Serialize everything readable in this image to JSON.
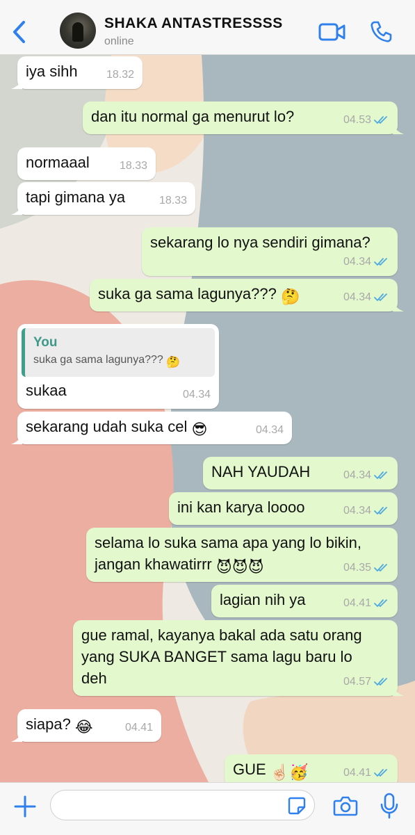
{
  "header": {
    "back_icon": "chevron-left-icon",
    "contact_name": "SHAKA ANTASTRESSSS",
    "status": "online",
    "video_icon": "video-camera-icon",
    "call_icon": "phone-icon",
    "accent": "#2f80ed"
  },
  "messages": [
    {
      "dir": "in",
      "text": "iya sihh",
      "time": "18.32"
    },
    {
      "dir": "out",
      "text": "dan itu normal ga menurut lo?",
      "time": "04.53",
      "read": true
    },
    {
      "dir": "in",
      "text": "normaaal",
      "time": "18.33"
    },
    {
      "dir": "in",
      "text": "tapi gimana ya",
      "time": "18.33"
    },
    {
      "dir": "out",
      "text": "sekarang lo nya sendiri gimana?",
      "time": "04.34",
      "read": true
    },
    {
      "dir": "out",
      "text": "suka ga sama lagunya???",
      "emoji": "🤔",
      "time": "04.34",
      "read": true
    },
    {
      "dir": "in",
      "quote_author": "You",
      "quote_text": "suka ga sama lagunya???",
      "quote_emoji": "🤔",
      "text": "sukaa",
      "time": "04.34"
    },
    {
      "dir": "in",
      "text": "sekarang udah suka cel",
      "emoji": "😎",
      "time": "04.34"
    },
    {
      "dir": "out",
      "text": "NAH YAUDAH",
      "time": "04.34",
      "read": true
    },
    {
      "dir": "out",
      "text": "ini kan karya loooo",
      "time": "04.34",
      "read": true
    },
    {
      "dir": "out",
      "text": "selama lo suka sama apa yang lo bikin,\njangan khawatirrr",
      "emoji": "😈😈😈",
      "time": "04.35",
      "read": true
    },
    {
      "dir": "out",
      "text": "lagian nih ya",
      "time": "04.41",
      "read": true
    },
    {
      "dir": "out",
      "text": "gue ramal, kayanya bakal ada satu orang\nyang SUKA BANGET sama lagu baru lo\ndeh",
      "time": "04.57",
      "read": true
    },
    {
      "dir": "in",
      "text": "siapa?",
      "emoji": "😂",
      "time": "04.41"
    },
    {
      "dir": "out",
      "text": "GUE",
      "emoji": "☝🏻🥳",
      "time": "04.41",
      "read": true
    }
  ],
  "input": {
    "plus_icon": "plus-icon",
    "placeholder": "",
    "sticker_icon": "sticker-icon",
    "camera_icon": "camera-icon",
    "mic_icon": "microphone-icon"
  },
  "colors": {
    "incoming_bubble": "#ffffff",
    "outgoing_bubble": "#e3f8cd",
    "read_ticks": "#4fa9e0",
    "quote_bar": "#3f9f8d"
  }
}
